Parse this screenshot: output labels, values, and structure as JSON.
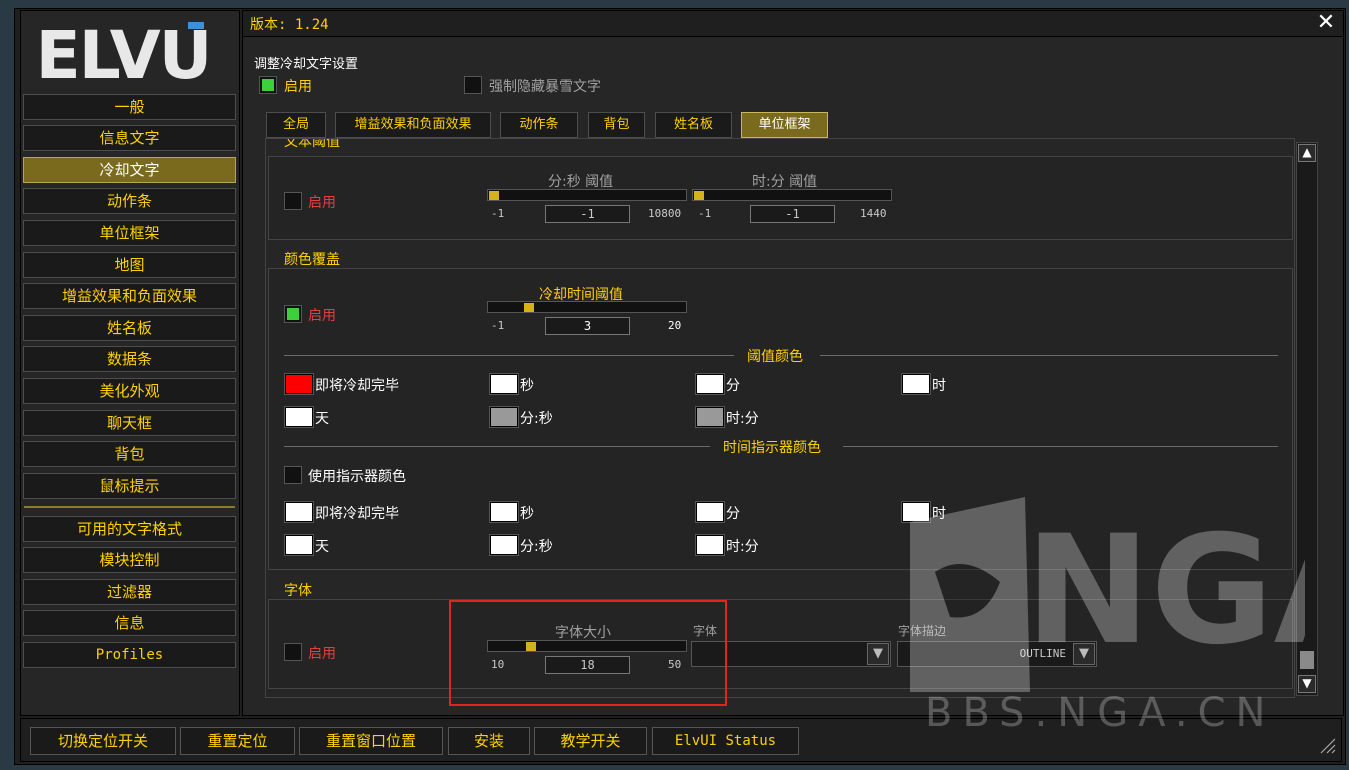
{
  "logo": {
    "text": "ELVUI"
  },
  "sidebar": {
    "items": [
      {
        "label": "一般"
      },
      {
        "label": "信息文字"
      },
      {
        "label": "冷却文字",
        "active": true
      },
      {
        "label": "动作条"
      },
      {
        "label": "单位框架"
      },
      {
        "label": "地图"
      },
      {
        "label": "增益效果和负面效果"
      },
      {
        "label": "姓名板"
      },
      {
        "label": "数据条"
      },
      {
        "label": "美化外观"
      },
      {
        "label": "聊天框"
      },
      {
        "label": "背包"
      },
      {
        "label": "鼠标提示"
      }
    ],
    "items2": [
      {
        "label": "可用的文字格式"
      },
      {
        "label": "模块控制"
      },
      {
        "label": "过滤器"
      },
      {
        "label": "信息"
      },
      {
        "label": "Profiles"
      }
    ]
  },
  "header": {
    "version": "版本: 1.24",
    "close": "✕"
  },
  "settings": {
    "title": "调整冷却文字设置",
    "enable_label": "启用",
    "enable_checked": true,
    "force_hide_label": "强制隐藏暴雪文字",
    "force_hide_checked": false
  },
  "tabs": [
    {
      "label": "全局"
    },
    {
      "label": "增益效果和负面效果"
    },
    {
      "label": "动作条"
    },
    {
      "label": "背包"
    },
    {
      "label": "姓名板"
    },
    {
      "label": "单位框架",
      "active": true
    }
  ],
  "threshold_group": {
    "title": "文本阈值",
    "enable_label": "启用",
    "mmss": {
      "label": "分:秒 阈值",
      "min": "-1",
      "max": "10800",
      "value": "-1",
      "fraction": 0.0
    },
    "hhmm": {
      "label": "时:分 阈值",
      "min": "-1",
      "max": "1440",
      "value": "-1",
      "fraction": 0.0
    }
  },
  "color_group": {
    "title": "颜色覆盖",
    "enable_label": "启用",
    "slider": {
      "label": "冷却时间阈值",
      "min": "-1",
      "max": "20",
      "value": "3",
      "fraction": 0.19
    },
    "threshold_colors_title": "阈值颜色",
    "threshold_colors": [
      {
        "label": "即将冷却完毕",
        "color": "#ff0000"
      },
      {
        "label": "秒",
        "color": "#ffffff"
      },
      {
        "label": "分",
        "color": "#ffffff"
      },
      {
        "label": "时",
        "color": "#ffffff"
      },
      {
        "label": "天",
        "color": "#ffffff"
      },
      {
        "label": "分:秒",
        "color": "#999999"
      },
      {
        "label": "时:分",
        "color": "#999999"
      }
    ],
    "indicator_title": "时间指示器颜色",
    "use_indicator_label": "使用指示器颜色",
    "indicator_colors": [
      {
        "label": "即将冷却完毕",
        "color": "#ffffff"
      },
      {
        "label": "秒",
        "color": "#ffffff"
      },
      {
        "label": "分",
        "color": "#ffffff"
      },
      {
        "label": "时",
        "color": "#ffffff"
      },
      {
        "label": "天",
        "color": "#ffffff"
      },
      {
        "label": "分:秒",
        "color": "#ffffff"
      },
      {
        "label": "时:分",
        "color": "#ffffff"
      }
    ]
  },
  "font_group": {
    "title": "字体",
    "enable_label": "启用",
    "size": {
      "label": "字体大小",
      "min": "10",
      "max": "50",
      "value": "18",
      "fraction": 0.2
    },
    "font_label": "字体",
    "font_value": "",
    "outline_label": "字体描边",
    "outline_value": "OUTLINE"
  },
  "bottom": {
    "buttons": [
      {
        "label": "切换定位开关"
      },
      {
        "label": "重置定位"
      },
      {
        "label": "重置窗口位置"
      },
      {
        "label": "安装"
      },
      {
        "label": "教学开关"
      },
      {
        "label": "ElvUI Status"
      }
    ]
  },
  "watermark": {
    "brand": "NGA",
    "url": "BBS.NGA.CN"
  },
  "colors": {
    "accent": "#ffd100",
    "active_bg": "#7a6a1e",
    "enabled_text": "#e04040",
    "checkbox_on": "#3cd13c",
    "highlight": "#e0251f"
  }
}
